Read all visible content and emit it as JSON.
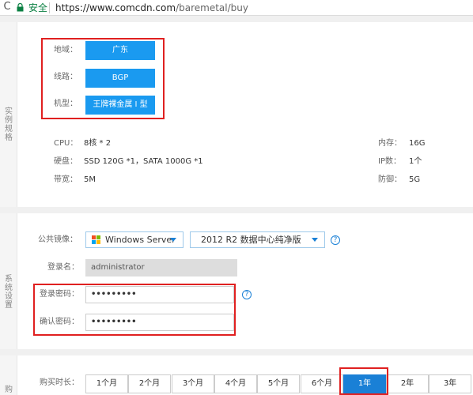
{
  "browser": {
    "secure_label": "安全",
    "url_host": "https://www.comcdn.com",
    "url_path": "/baremetal/buy"
  },
  "spec_section": {
    "side_label": "实例规格",
    "region": {
      "label": "地域：",
      "value": "广东"
    },
    "line": {
      "label": "线路：",
      "value": "BGP"
    },
    "model": {
      "label": "机型：",
      "value": "王牌裸金属 I 型"
    },
    "specs": {
      "cpu_label": "CPU：",
      "cpu_value": "8核 * 2",
      "memory_label": "内存：",
      "memory_value": "16G",
      "disk_label": "硬盘：",
      "disk_value": "SSD 120G *1，SATA 1000G *1",
      "ip_label": "IP数：",
      "ip_value": "1个",
      "bandwidth_label": "带宽：",
      "bandwidth_value": "5M",
      "defense_label": "防御：",
      "defense_value": "5G"
    }
  },
  "system_section": {
    "side_label": "系统设置",
    "image_label": "公共镜像：",
    "os_select": "Windows Server",
    "version_select": "2012 R2 数据中心纯净版",
    "login_label": "登录名：",
    "login_value": "administrator",
    "password_label": "登录密码：",
    "password_value": "•••••••••",
    "confirm_label": "确认密码：",
    "confirm_value": "•••••••••",
    "help_glyph": "?"
  },
  "purchase_section": {
    "side_label": "购",
    "duration_label": "购买时长：",
    "durations": [
      "1个月",
      "2个月",
      "3个月",
      "4个月",
      "5个月",
      "6个月",
      "1年",
      "2年",
      "3年"
    ],
    "selected": "1年"
  },
  "colors": {
    "accent": "#1a9af0",
    "selected": "#1a80d6",
    "highlight": "#e02020"
  }
}
